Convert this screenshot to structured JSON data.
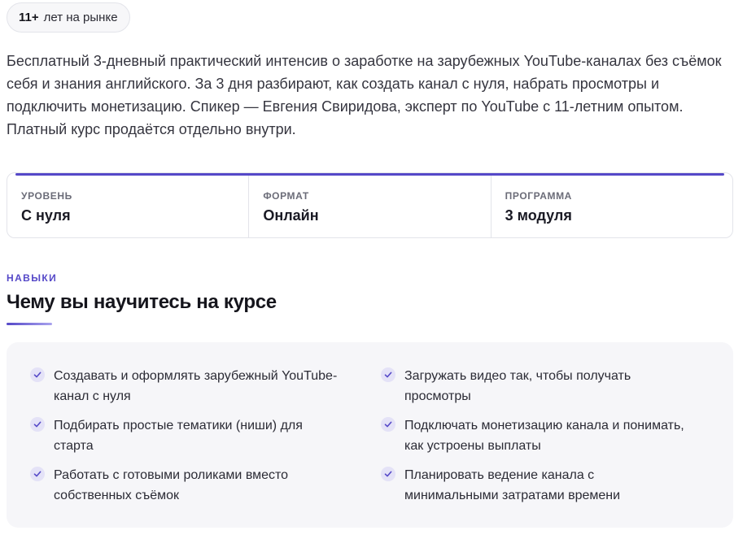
{
  "badge": {
    "number": "11+",
    "text": "лет на рынке"
  },
  "description": "Бесплатный 3-дневный практический интенсив о заработке на зарубежных YouTube-каналах без съёмок себя и знания английского. За 3 дня разбирают, как создать канал с нуля, набрать просмотры и подключить монетизацию. Спикер — Евгения Свиридова, эксперт по YouTube с 11-летним опытом. Платный курс продаётся отдельно внутри.",
  "stats": [
    {
      "label": "УРОВЕНЬ",
      "value": "С нуля"
    },
    {
      "label": "ФОРМАТ",
      "value": "Онлайн"
    },
    {
      "label": "ПРОГРАММА",
      "value": "3 модуля"
    }
  ],
  "skills_section": {
    "eyebrow": "НАВЫКИ",
    "heading": "Чему вы научитесь на курсе",
    "items": [
      "Создавать и оформлять зарубежный YouTube-канал с нуля",
      "Загружать видео так, чтобы получать просмотры",
      "Подбирать простые тематики (ниши) для старта",
      "Подключать монетизацию канала и понимать, как устроены выплаты",
      "Работать с готовыми роликами вместо собственных съёмок",
      "Планировать ведение канала с минимальными затратами времени"
    ]
  },
  "icons": {
    "skill_bullet": "checkmark-icon"
  },
  "colors": {
    "accent": "#5548c8",
    "panel": "#f6f6f9",
    "border": "#e3e4ea"
  }
}
